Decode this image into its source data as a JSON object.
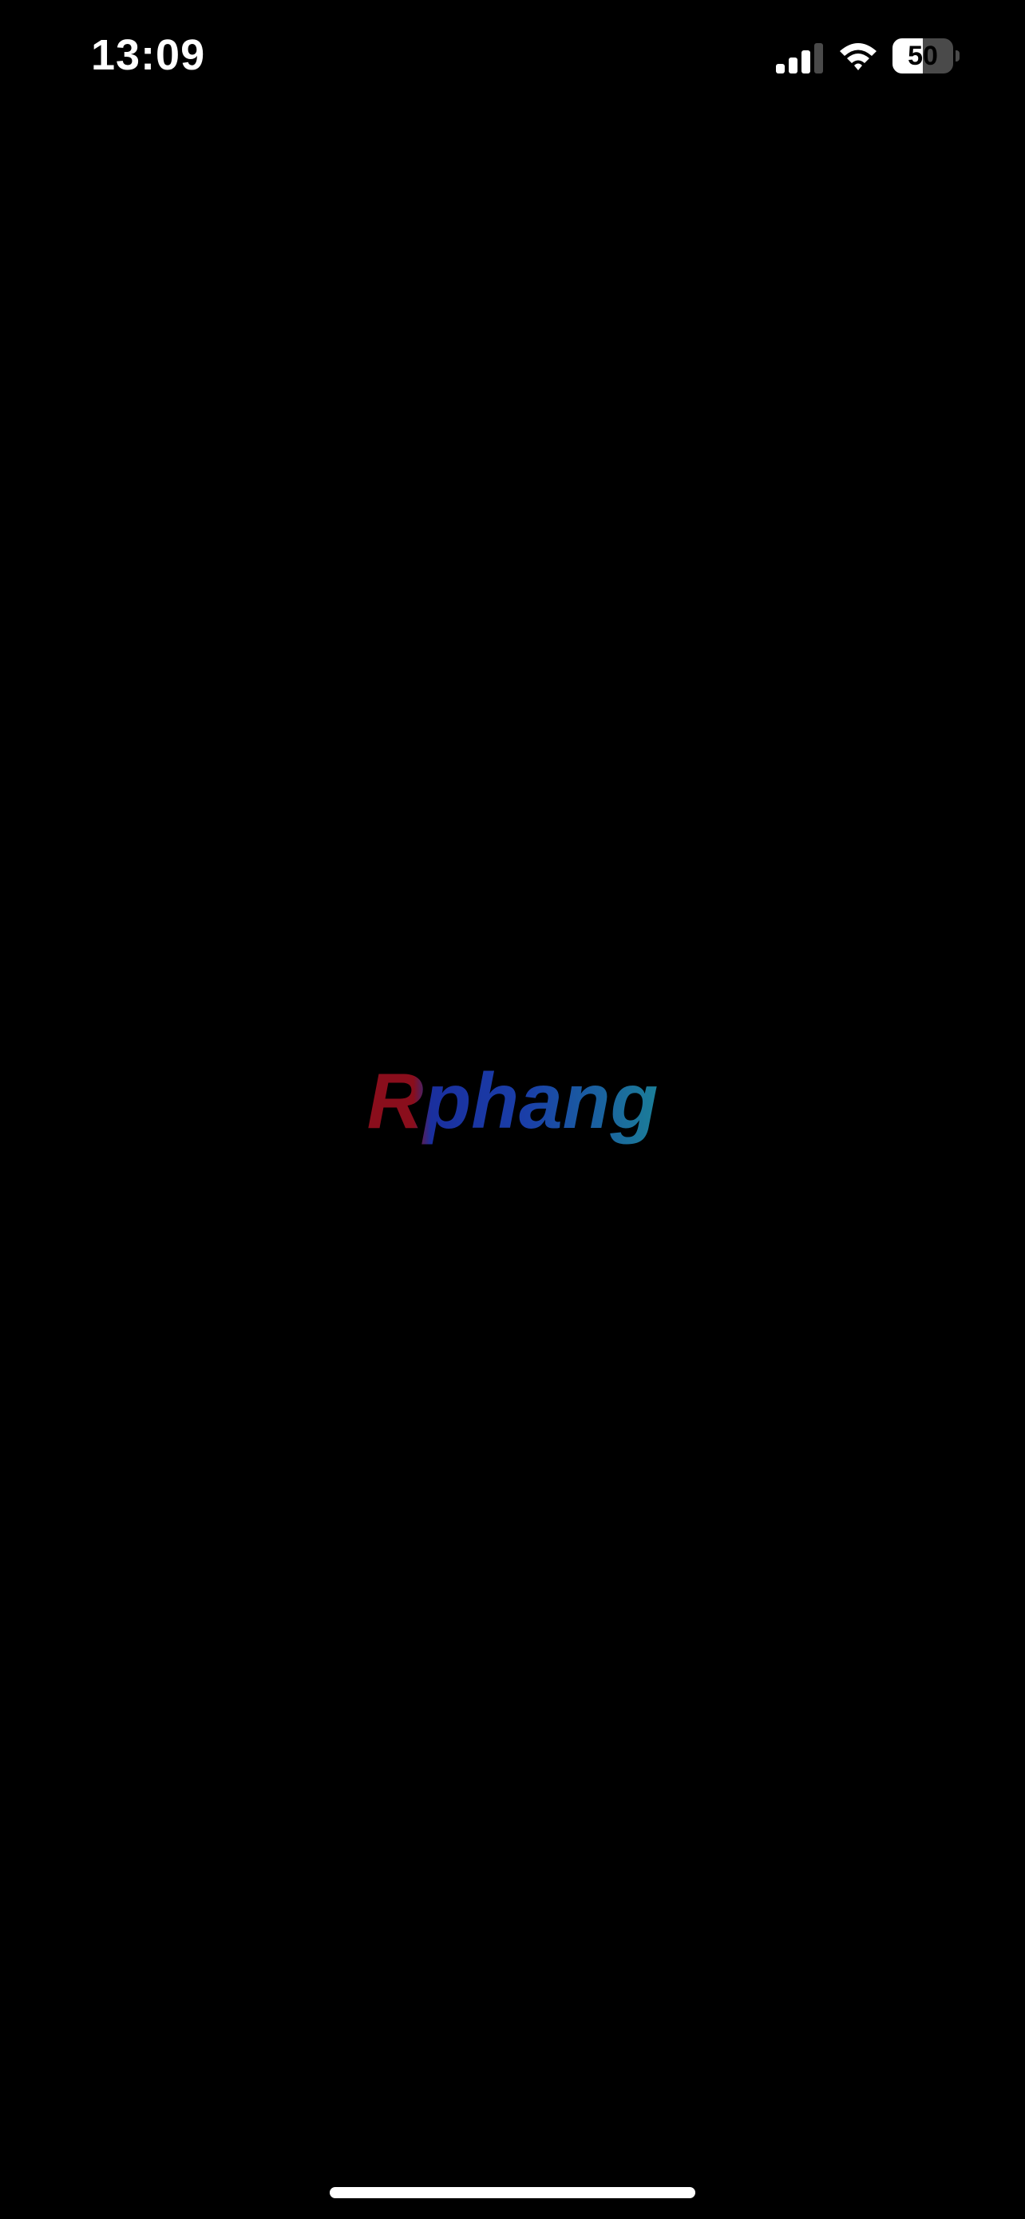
{
  "status_bar": {
    "time": "13:09",
    "battery_level": "50",
    "battery_fraction": 0.5,
    "signal_bars_active": 3,
    "signal_bars_total": 4,
    "icons": [
      "signal-icon",
      "wifi-icon",
      "battery-icon"
    ]
  },
  "splash": {
    "logo_text": "Rphang",
    "colors": {
      "background": "#000000",
      "logo_red": "#8a0e1c",
      "logo_blue": "#1a2f9e",
      "logo_teal": "#1b7e98"
    }
  }
}
